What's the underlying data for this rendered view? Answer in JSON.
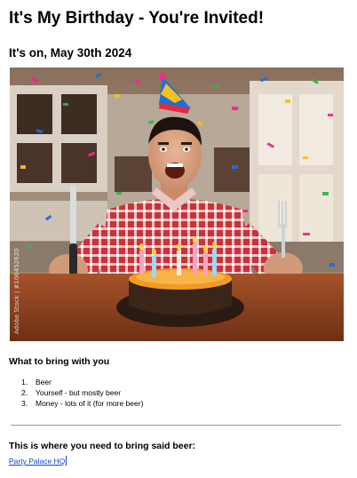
{
  "invite": {
    "title": "It's My Birthday - You're Invited!",
    "date_line": "It's on, May 30th 2024"
  },
  "photo": {
    "watermark": "Adobe Stock | #106452620"
  },
  "bring": {
    "heading": "What to bring with you",
    "items": [
      {
        "num": "1.",
        "text": "Beer"
      },
      {
        "num": "2.",
        "text": "Yourself - but mostly beer"
      },
      {
        "num": "3.",
        "text": "Money - lots of it (for more beer)"
      }
    ]
  },
  "location": {
    "heading": "This is where you need to bring said beer:",
    "link_text": "Party Palace HQ"
  },
  "colors": {
    "link": "#1a3fd6",
    "table": "#8a3f1e",
    "shirt": "#c8323a",
    "frosting": "#f29a24"
  }
}
